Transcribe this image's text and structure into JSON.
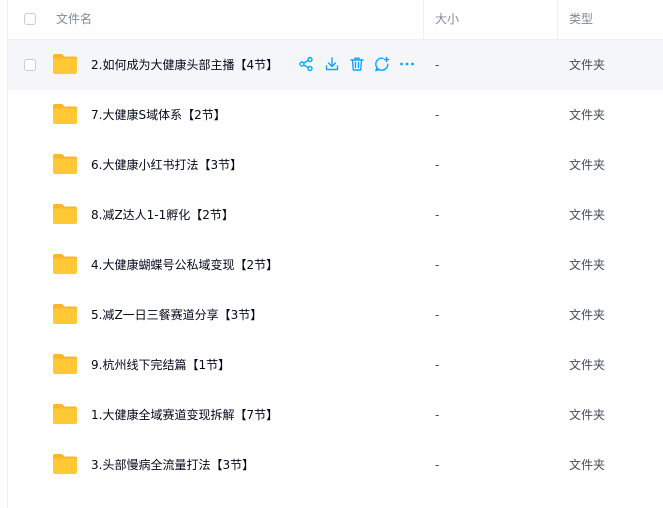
{
  "header": {
    "name_label": "文件名",
    "size_label": "大小",
    "type_label": "类型"
  },
  "rows": [
    {
      "name": "2.如何成为大健康头部主播【4节】",
      "size": "-",
      "type": "文件夹"
    },
    {
      "name": "7.大健康S域体系【2节】",
      "size": "-",
      "type": "文件夹"
    },
    {
      "name": "6.大健康小红书打法【3节】",
      "size": "-",
      "type": "文件夹"
    },
    {
      "name": "8.减Z达人1-1孵化【2节】",
      "size": "-",
      "type": "文件夹"
    },
    {
      "name": "4.大健康蝴蝶号公私域变现【2节】",
      "size": "-",
      "type": "文件夹"
    },
    {
      "name": "5.减Z一日三餐赛道分享【3节】",
      "size": "-",
      "type": "文件夹"
    },
    {
      "name": "9.杭州线下完结篇【1节】",
      "size": "-",
      "type": "文件夹"
    },
    {
      "name": "1.大健康全域赛道变现拆解【7节】",
      "size": "-",
      "type": "文件夹"
    },
    {
      "name": "3.头部慢病全流量打法【3节】",
      "size": "-",
      "type": "文件夹"
    }
  ],
  "row_actions": [
    "share-icon",
    "download-icon",
    "delete-icon",
    "comment-icon",
    "more-icon"
  ],
  "colors": {
    "accent": "#06a7ff",
    "folder": "#ffc936",
    "folder_back": "#ffb52a",
    "hover_bg": "#f5f6fa"
  }
}
